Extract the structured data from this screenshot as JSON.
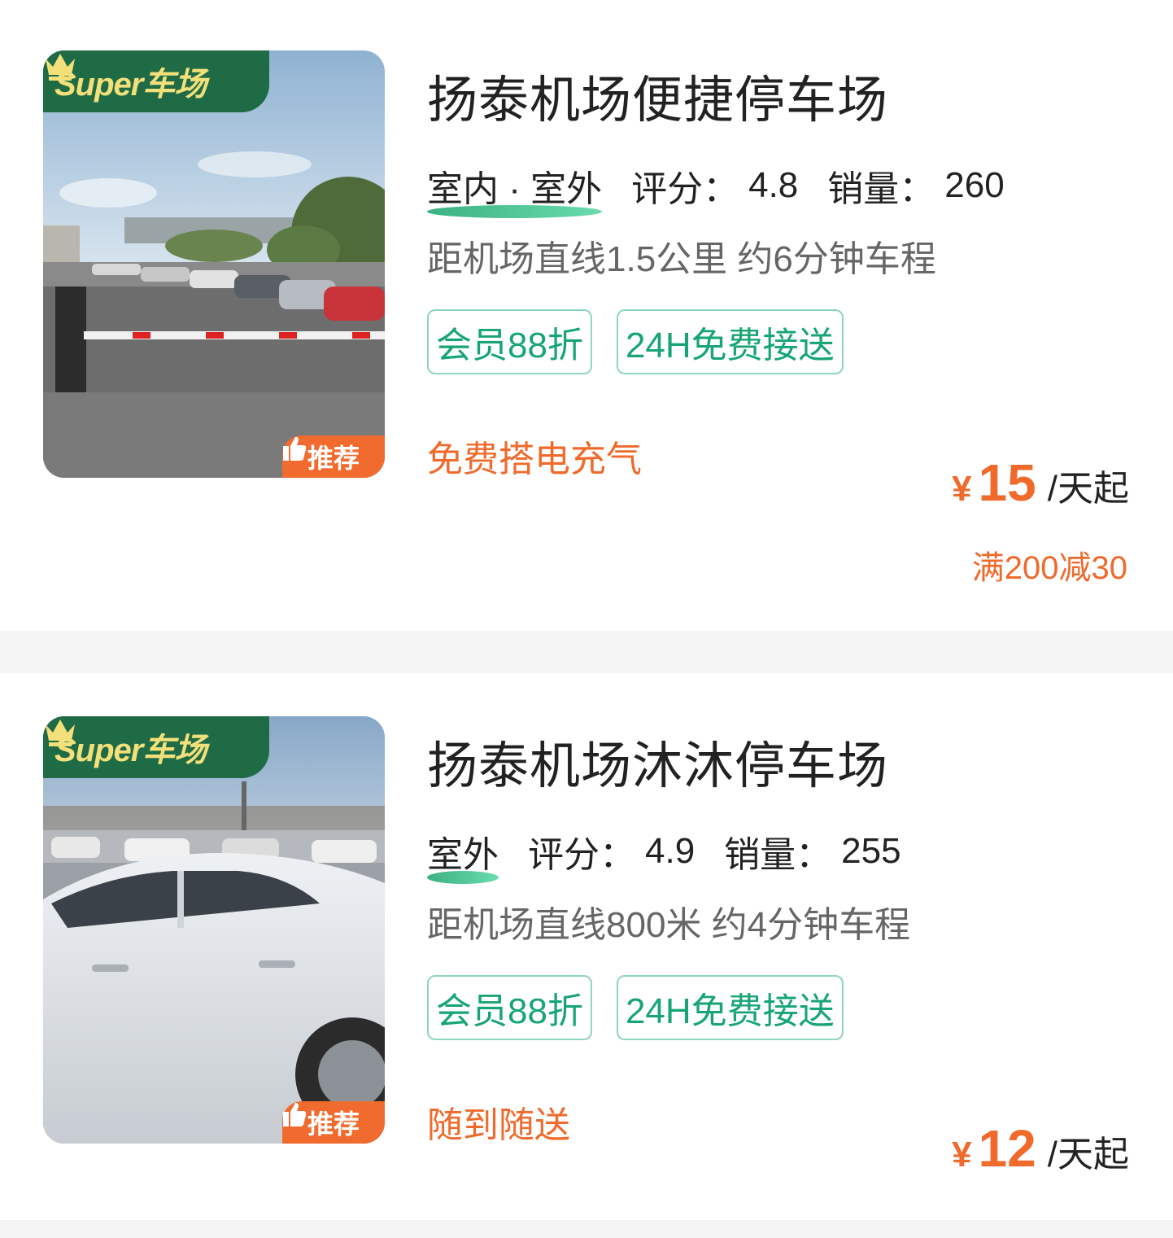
{
  "colors": {
    "brand_green": "#1e6b45",
    "super_gold": "#f3e07a",
    "accent_orange": "#f06a2c",
    "tag_green": "#17a673",
    "tag_border": "#8fd6be",
    "divider_gray": "#f5f5f5"
  },
  "listings": [
    {
      "badge": "Super车场",
      "badge_icon": "crown-icon",
      "recommend": "推荐",
      "recommend_icon": "thumbs-up-icon",
      "name": "扬泰机场便捷停车场",
      "type": "室内 · 室外",
      "rating_label": "评分：",
      "rating": "4.8",
      "sales_label": "销量：",
      "sales": "260",
      "distance": "距机场直线1.5公里 约6分钟车程",
      "tags": [
        "会员88折",
        "24H免费接送"
      ],
      "perk": "免费搭电充气",
      "currency": "¥",
      "price": "15",
      "price_unit": "/天起",
      "discount": "满200减30"
    },
    {
      "badge": "Super车场",
      "badge_icon": "crown-icon",
      "recommend": "推荐",
      "recommend_icon": "thumbs-up-icon",
      "name": "扬泰机场沐沐停车场",
      "type": "室外",
      "rating_label": "评分：",
      "rating": "4.9",
      "sales_label": "销量：",
      "sales": "255",
      "distance": "距机场直线800米 约4分钟车程",
      "tags": [
        "会员88折",
        "24H免费接送"
      ],
      "perk": "随到随送",
      "currency": "¥",
      "price": "12",
      "price_unit": "/天起"
    }
  ]
}
